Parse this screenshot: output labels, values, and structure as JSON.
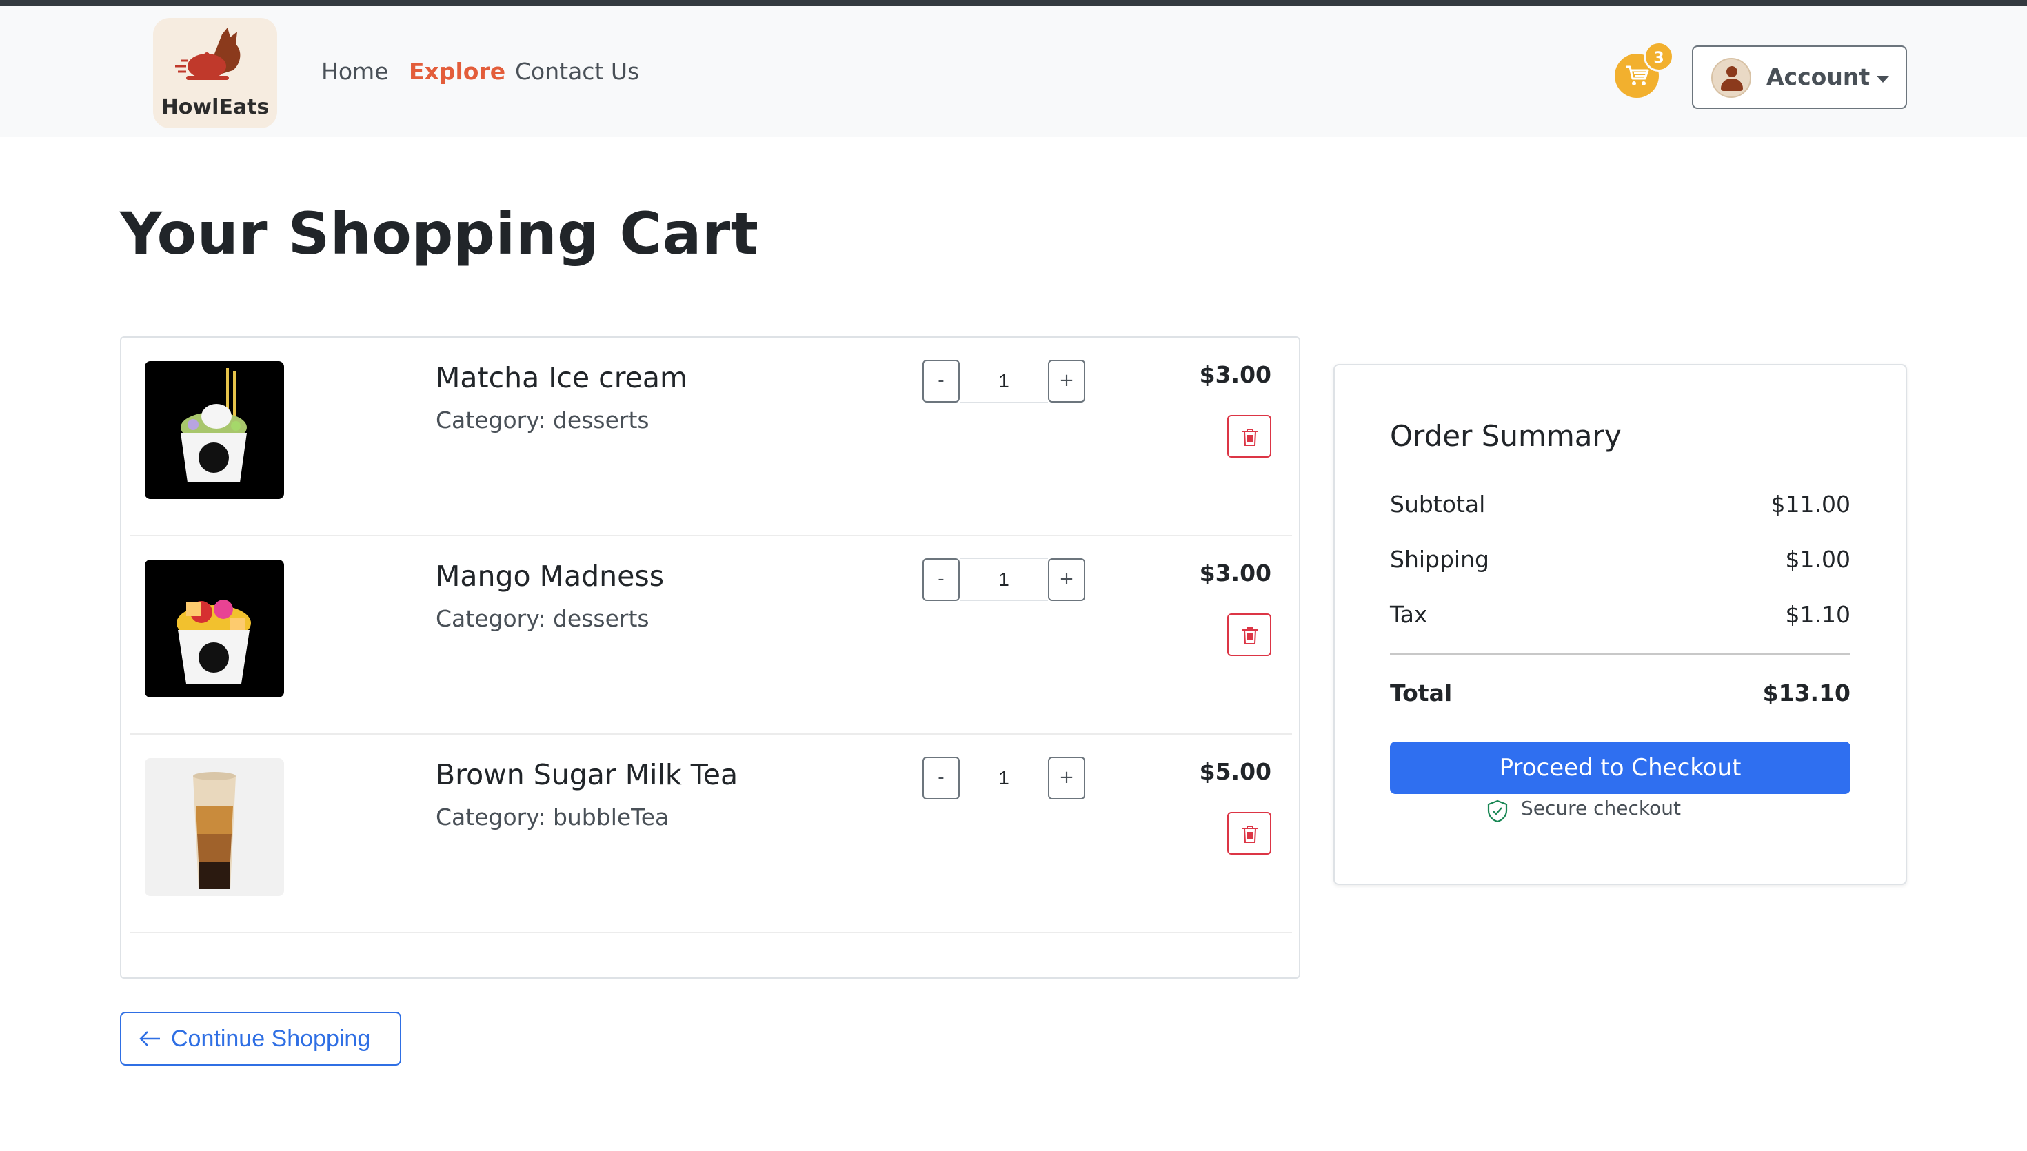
{
  "brand": {
    "name": "HowlEats"
  },
  "nav": {
    "home": "Home",
    "explore": "Explore",
    "contact": "Contact Us"
  },
  "header": {
    "cart_count": "3",
    "account_label": "Account"
  },
  "page": {
    "title": "Your Shopping Cart"
  },
  "cart": {
    "items": [
      {
        "name": "Matcha Ice cream",
        "category": "Category: desserts",
        "quantity": "1",
        "price": "$3.00",
        "image": "matcha-ice-cream-cup"
      },
      {
        "name": "Mango Madness",
        "category": "Category: desserts",
        "quantity": "1",
        "price": "$3.00",
        "image": "mango-fruit-cup"
      },
      {
        "name": "Brown Sugar Milk Tea",
        "category": "Category: bubbleTea",
        "quantity": "1",
        "price": "$5.00",
        "image": "brown-sugar-milk-tea-cup"
      }
    ],
    "minus_label": "-",
    "plus_label": "+"
  },
  "continue": {
    "label": "Continue Shopping"
  },
  "summary": {
    "title": "Order Summary",
    "subtotal_label": "Subtotal",
    "subtotal": "$11.00",
    "shipping_label": "Shipping",
    "shipping": "$1.00",
    "tax_label": "Tax",
    "tax": "$1.10",
    "total_label": "Total",
    "total": "$13.10",
    "checkout_label": "Proceed to Checkout",
    "secure_label": "Secure checkout"
  },
  "colors": {
    "accent": "#2f6ff0",
    "brand": "#e35d3a",
    "cart": "#f2b02e",
    "danger": "#dc3545"
  }
}
